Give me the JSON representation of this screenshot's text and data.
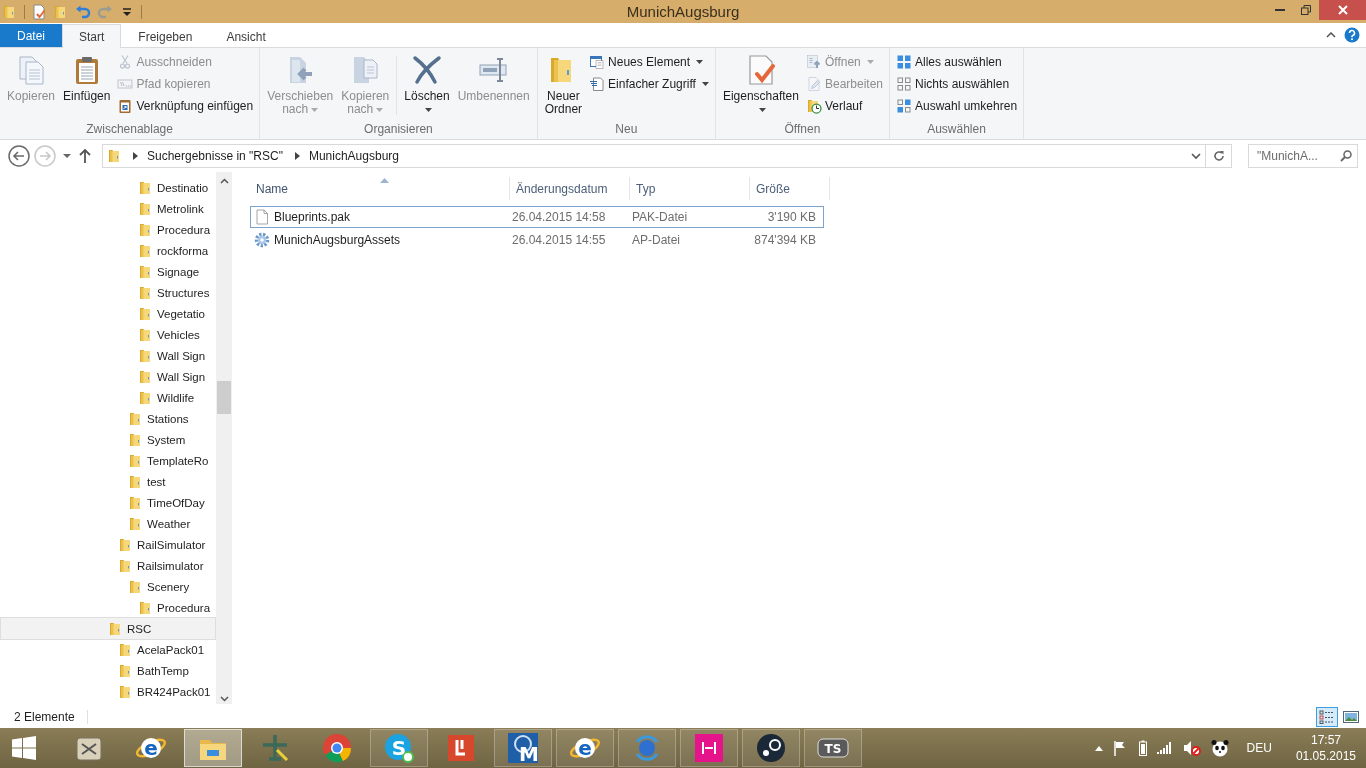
{
  "window": {
    "title": "MunichAugsburg"
  },
  "quick_access": [
    {
      "kind": "properties",
      "disabled": false
    },
    {
      "kind": "new-folder",
      "disabled": false
    },
    {
      "kind": "undo",
      "disabled": false
    },
    {
      "kind": "redo",
      "disabled": true
    },
    {
      "kind": "customize",
      "disabled": false
    }
  ],
  "ribbon": {
    "tabs": [
      {
        "label": "Datei",
        "kind": "file",
        "selected": false
      },
      {
        "label": "Start",
        "kind": "tab",
        "selected": true
      },
      {
        "label": "Freigeben",
        "kind": "tab",
        "selected": false
      },
      {
        "label": "Ansicht",
        "kind": "tab",
        "selected": false
      }
    ],
    "groups": [
      {
        "label": "Zwischenablage",
        "items": [
          {
            "kind": "copy",
            "label": "Kopieren",
            "disabled": true,
            "dropdown": false
          },
          {
            "kind": "paste",
            "label": "Einfügen",
            "disabled": false,
            "dropdown": false
          },
          {
            "items": [
              {
                "kind": "cut",
                "label": "Ausschneiden",
                "disabled": true,
                "dropdown": false
              },
              {
                "kind": "path",
                "label": "Pfad kopieren",
                "disabled": true,
                "dropdown": false
              },
              {
                "kind": "shortcut",
                "label": "Verknüpfung einfügen",
                "disabled": false,
                "dropdown": false
              }
            ]
          }
        ]
      },
      {
        "label": "Organisieren",
        "items": [
          {
            "kind": "move",
            "label": "Verschieben nach",
            "disabled": true,
            "dropdown": true
          },
          {
            "kind": "copyto",
            "label": "Kopieren nach",
            "disabled": true,
            "dropdown": true
          },
          {
            "kind": "separator"
          },
          {
            "kind": "delete",
            "label": "Löschen",
            "disabled": false,
            "dropdown": true
          },
          {
            "kind": "rename",
            "label": "Umbenennen",
            "disabled": true,
            "dropdown": false
          }
        ]
      },
      {
        "label": "Neu",
        "items": [
          {
            "kind": "newfolder",
            "label": "Neuer Ordner",
            "disabled": false,
            "dropdown": false
          },
          {
            "items": [
              {
                "kind": "newitem",
                "label": "Neues Element",
                "disabled": false,
                "dropdown": true
              },
              {
                "kind": "easyaccess",
                "label": "Einfacher Zugriff",
                "disabled": false,
                "dropdown": true
              }
            ]
          }
        ]
      },
      {
        "label": "Öffnen",
        "items": [
          {
            "kind": "properties",
            "label": "Eigenschaften",
            "disabled": false,
            "dropdown": true
          },
          {
            "items": [
              {
                "kind": "open",
                "label": "Öffnen",
                "disabled": true,
                "dropdown": true
              },
              {
                "kind": "edit",
                "label": "Bearbeiten",
                "disabled": true,
                "dropdown": false
              },
              {
                "kind": "history",
                "label": "Verlauf",
                "disabled": false,
                "dropdown": false
              }
            ]
          }
        ]
      },
      {
        "label": "Auswählen",
        "items": [
          {
            "items": [
              {
                "kind": "selall",
                "label": "Alles auswählen",
                "disabled": false,
                "dropdown": false
              },
              {
                "kind": "selnone",
                "label": "Nichts auswählen",
                "disabled": false,
                "dropdown": false
              },
              {
                "kind": "selinv",
                "label": "Auswahl umkehren",
                "disabled": false,
                "dropdown": false
              }
            ]
          }
        ]
      }
    ]
  },
  "navigation": {
    "back_disabled": false,
    "forward_disabled": true
  },
  "address": {
    "crumbs": [
      "Suchergebnisse in \"RSC\"",
      "MunichAugsburg"
    ]
  },
  "search": {
    "value": "\"MunichA..."
  },
  "nav_tree": [
    {
      "children": [
        {
          "children": [
            {
              "children": [
                {
                  "label": "Destinatio",
                  "selected": false
                },
                {
                  "label": "Metrolink",
                  "selected": false
                },
                {
                  "label": "Procedura",
                  "selected": false
                },
                {
                  "label": "rockforma",
                  "selected": false
                },
                {
                  "label": "Signage",
                  "selected": false
                },
                {
                  "label": "Structures",
                  "selected": false
                },
                {
                  "label": "Vegetatio",
                  "selected": false
                },
                {
                  "label": "Vehicles",
                  "selected": false
                },
                {
                  "label": "Wall Sign",
                  "selected": false
                },
                {
                  "label": "Wall Sign",
                  "selected": false
                },
                {
                  "label": "Wildlife",
                  "selected": false
                }
              ]
            },
            {
              "label": "Stations",
              "selected": false
            },
            {
              "label": "System",
              "selected": false
            },
            {
              "label": "TemplateRo",
              "selected": false
            },
            {
              "label": "test",
              "selected": false
            },
            {
              "label": "TimeOfDay",
              "selected": false
            },
            {
              "label": "Weather",
              "selected": false
            }
          ]
        },
        {
          "label": "RailSimulator",
          "selected": false
        },
        {
          "label": "Railsimulator",
          "selected": false,
          "children": [
            {
              "label": "Scenery",
              "selected": false,
              "children": [
                {
                  "label": "Procedura",
                  "selected": false
                }
              ]
            }
          ]
        }
      ]
    },
    {
      "label": "RSC",
      "selected": true,
      "children": [
        {
          "label": "AcelaPack01",
          "selected": false
        },
        {
          "label": "BathTemp",
          "selected": false
        },
        {
          "label": "BR424Pack01",
          "selected": false
        }
      ]
    }
  ],
  "file_list": {
    "columns": [
      {
        "label": "Name",
        "sorted": true
      },
      {
        "label": "Änderungsdatum",
        "sorted": false
      },
      {
        "label": "Typ",
        "sorted": false
      },
      {
        "label": "Größe",
        "sorted": false
      }
    ],
    "rows": [
      {
        "kind": "document",
        "name": "Blueprints.pak",
        "date": "26.04.2015 14:58",
        "type": "PAK-Datei",
        "size": "3'190 KB",
        "focused": true
      },
      {
        "kind": "settings",
        "name": "MunichAugsburgAssets",
        "date": "26.04.2015 14:55",
        "type": "AP-Datei",
        "size": "874'394 KB",
        "focused": false
      }
    ]
  },
  "status_bar": {
    "text": "2 Elemente",
    "views": [
      {
        "kind": "details",
        "selected": true
      },
      {
        "kind": "large-icons",
        "selected": false
      }
    ]
  },
  "taskbar": {
    "items": [
      {
        "kind": "tool",
        "running": false,
        "active": false
      },
      {
        "kind": "ie",
        "label": "e",
        "running": false,
        "active": false
      },
      {
        "kind": "explorer",
        "running": true,
        "active": true
      },
      {
        "kind": "plane",
        "running": false,
        "active": false
      },
      {
        "kind": "chrome",
        "running": false,
        "active": false
      },
      {
        "kind": "skype",
        "label": "S",
        "running": true,
        "active": false
      },
      {
        "kind": "redapp",
        "running": false,
        "active": false
      },
      {
        "kind": "modm",
        "label": "M",
        "running": true,
        "active": false
      },
      {
        "kind": "ie",
        "label": "e",
        "running": true,
        "active": false
      },
      {
        "kind": "sync",
        "running": true,
        "active": false
      },
      {
        "kind": "magenta",
        "running": true,
        "active": false
      },
      {
        "kind": "steam",
        "running": true,
        "active": false
      },
      {
        "kind": "ts",
        "label": "TS",
        "running": true,
        "active": false
      }
    ],
    "tray": {
      "volume_muted": true,
      "language": "DEU",
      "time": "17:57",
      "date": "01.05.2015"
    }
  }
}
